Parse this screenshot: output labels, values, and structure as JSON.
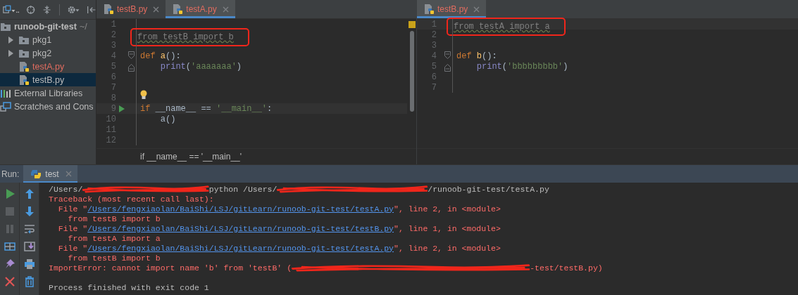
{
  "project_panel": {
    "tree": [
      {
        "label": "runoob-git-test",
        "path": "~/",
        "kind": "project",
        "selected": false,
        "children": [
          {
            "label": "pkg1",
            "kind": "folder",
            "expanded": false,
            "selected": false
          },
          {
            "label": "pkg2",
            "kind": "folder",
            "expanded": false,
            "selected": false
          },
          {
            "label": "testA.py",
            "kind": "file",
            "error": true,
            "selected": false
          },
          {
            "label": "testB.py",
            "kind": "file",
            "error": false,
            "selected": true
          }
        ]
      },
      {
        "label": "External Libraries",
        "kind": "library",
        "selected": false
      },
      {
        "label": "Scratches and Cons",
        "kind": "scratch",
        "selected": false
      }
    ]
  },
  "editors": [
    {
      "tabs": [
        {
          "label": "testB.py",
          "selected": false,
          "error": true
        },
        {
          "label": "testA.py",
          "selected": true,
          "error": true
        }
      ],
      "lines": [
        {
          "number": "1"
        },
        {
          "number": "2",
          "annotated": true,
          "tokens": [
            {
              "kind": "unused",
              "text": "from testB import b"
            }
          ]
        },
        {
          "number": "3"
        },
        {
          "number": "4",
          "fold_start": true,
          "tokens": [
            {
              "kind": "kw",
              "text": "def "
            },
            {
              "kind": "fn",
              "text": "a"
            },
            {
              "kind": "plain",
              "text": "():"
            }
          ]
        },
        {
          "number": "5",
          "fold_end": true,
          "indented": true,
          "tokens": [
            {
              "kind": "builtin",
              "text": "print"
            },
            {
              "kind": "plain",
              "text": "("
            },
            {
              "kind": "str",
              "text": "'aaaaaaa'"
            },
            {
              "kind": "plain",
              "text": ")"
            }
          ]
        },
        {
          "number": "6"
        },
        {
          "number": "7"
        },
        {
          "number": "8",
          "bulb": true
        },
        {
          "number": "9",
          "current": true,
          "run_marker": true,
          "tokens": [
            {
              "kind": "kw",
              "text": "if "
            },
            {
              "kind": "plain",
              "text": "__name__ == "
            },
            {
              "kind": "str",
              "text": "'__main__'"
            },
            {
              "kind": "plain",
              "text": ":"
            }
          ]
        },
        {
          "number": "10",
          "indented": true,
          "tokens": [
            {
              "kind": "plain",
              "text": "a()"
            }
          ]
        },
        {
          "number": "11"
        },
        {
          "number": "12"
        }
      ],
      "breadcrumb": "if __name__ == '__main__'"
    },
    {
      "tabs": [
        {
          "label": "testB.py",
          "selected": true,
          "error": true
        }
      ],
      "lines": [
        {
          "number": "1",
          "annotated": true,
          "current": true,
          "tokens": [
            {
              "kind": "unused",
              "text": "from testA import a"
            }
          ]
        },
        {
          "number": "2"
        },
        {
          "number": "3"
        },
        {
          "number": "4",
          "fold_start": true,
          "tokens": [
            {
              "kind": "kw",
              "text": "def "
            },
            {
              "kind": "fn",
              "text": "b"
            },
            {
              "kind": "plain",
              "text": "():"
            }
          ]
        },
        {
          "number": "5",
          "fold_end": true,
          "indented": true,
          "tokens": [
            {
              "kind": "builtin",
              "text": "print"
            },
            {
              "kind": "plain",
              "text": "("
            },
            {
              "kind": "str",
              "text": "'bbbbbbbbb'"
            },
            {
              "kind": "plain",
              "text": ")"
            }
          ]
        },
        {
          "number": "6"
        },
        {
          "number": "7"
        }
      ]
    }
  ],
  "run_panel": {
    "label": "Run:",
    "tabs": [
      {
        "label": "test",
        "selected": true
      }
    ],
    "console": [
      {
        "segments": [
          {
            "kind": "text",
            "text": "/Users/"
          },
          {
            "kind": "redacted"
          },
          {
            "kind": "text",
            "text": "python /Users/"
          },
          {
            "kind": "redacted"
          },
          {
            "kind": "text",
            "text": "/runoob-git-test/testA.py"
          }
        ]
      },
      {
        "segments": [
          {
            "kind": "error",
            "text": "Traceback (most recent call last):"
          }
        ]
      },
      {
        "segments": [
          {
            "kind": "error",
            "text": "  File \""
          },
          {
            "kind": "link",
            "text": "/Users/fengxiaolan/BaiShi/LSJ/gitLearn/runoob-git-test/testA.py"
          },
          {
            "kind": "error",
            "text": "\", line 2, in <module>"
          }
        ]
      },
      {
        "segments": [
          {
            "kind": "error",
            "text": "    from testB import b"
          }
        ]
      },
      {
        "segments": [
          {
            "kind": "error",
            "text": "  File \""
          },
          {
            "kind": "link",
            "text": "/Users/fengxiaolan/BaiShi/LSJ/gitLearn/runoob-git-test/testB.py"
          },
          {
            "kind": "error",
            "text": "\", line 1, in <module>"
          }
        ]
      },
      {
        "segments": [
          {
            "kind": "error",
            "text": "    from testA import a"
          }
        ]
      },
      {
        "segments": [
          {
            "kind": "error",
            "text": "  File \""
          },
          {
            "kind": "link",
            "text": "/Users/fengxiaolan/BaiShi/LSJ/gitLearn/runoob-git-test/testA.py"
          },
          {
            "kind": "error",
            "text": "\", line 2, in <module>"
          }
        ]
      },
      {
        "segments": [
          {
            "kind": "error",
            "text": "    from testB import b"
          }
        ]
      },
      {
        "segments": [
          {
            "kind": "error",
            "text": "ImportError: cannot import name 'b' from 'testB' ("
          },
          {
            "kind": "redacted"
          },
          {
            "kind": "error",
            "text": "-test/testB.py)"
          }
        ]
      },
      {
        "spaced": true,
        "segments": [
          {
            "kind": "text",
            "text": "Process finished with exit code 1"
          }
        ]
      }
    ]
  }
}
